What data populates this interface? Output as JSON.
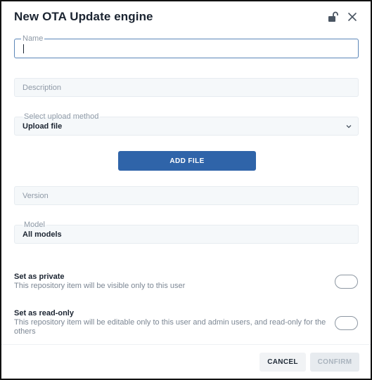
{
  "dialog": {
    "title": "New OTA Update engine",
    "icons": {
      "lock": "unlocked-padlock-icon",
      "close": "close-icon"
    }
  },
  "form": {
    "name": {
      "label": "Name",
      "value": ""
    },
    "description": {
      "placeholder": "Description"
    },
    "upload_method": {
      "label": "Select upload method",
      "value": "Upload file"
    },
    "add_file_label": "ADD FILE",
    "version": {
      "placeholder": "Version"
    },
    "model": {
      "label": "Model",
      "value": "All models"
    }
  },
  "toggles": {
    "private": {
      "title": "Set as private",
      "description": "This repository item will be visible only to this user",
      "on": false
    },
    "read_only": {
      "title": "Set as read-only",
      "description": "This repository item will be editable only to this user and admin users, and read-only for the others",
      "on": false
    }
  },
  "footer": {
    "cancel_label": "CANCEL",
    "confirm_label": "CONFIRM"
  },
  "colors": {
    "primary": "#2f64a9",
    "focus_border": "#5b86b8",
    "field_bg": "#f5f8fa",
    "disabled_text": "#aab4be"
  }
}
